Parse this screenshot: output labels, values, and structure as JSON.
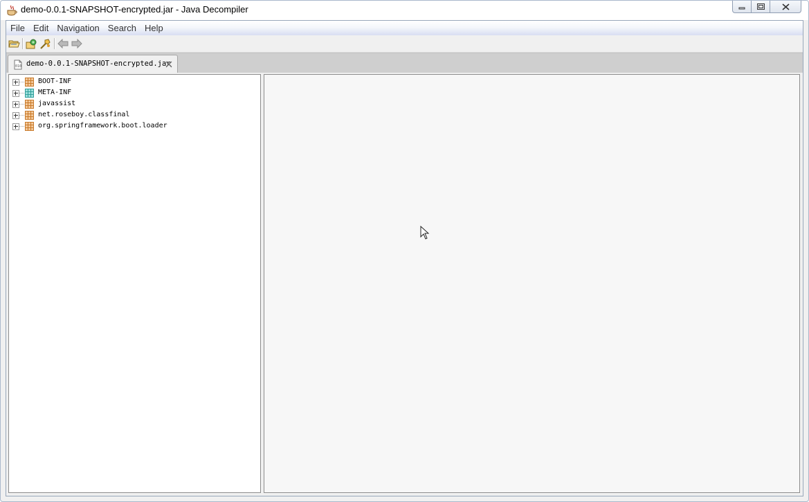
{
  "window": {
    "title": "demo-0.0.1-SNAPSHOT-encrypted.jar - Java Decompiler"
  },
  "menu": {
    "items": [
      {
        "label": "File"
      },
      {
        "label": "Edit"
      },
      {
        "label": "Navigation"
      },
      {
        "label": "Search"
      },
      {
        "label": "Help"
      }
    ]
  },
  "toolbar": {
    "buttons": [
      "open-file-icon",
      "open-type-icon",
      "search-icon",
      "back-arrow-icon",
      "forward-arrow-icon"
    ]
  },
  "tabs": [
    {
      "label": "demo-0.0.1-SNAPSHOT-encrypted.jar",
      "icon": "jar-file-icon"
    }
  ],
  "tree": {
    "items": [
      {
        "label": "BOOT-INF",
        "icon": "package-icon",
        "color": "#d98c2f"
      },
      {
        "label": "META-INF",
        "icon": "folder-package-icon",
        "color": "#2f9e9a"
      },
      {
        "label": "javassist",
        "icon": "package-icon",
        "color": "#d98c2f"
      },
      {
        "label": "net.roseboy.classfinal",
        "icon": "package-icon",
        "color": "#d98c2f"
      },
      {
        "label": "org.springframework.boot.loader",
        "icon": "package-icon",
        "color": "#d98c2f"
      }
    ]
  }
}
